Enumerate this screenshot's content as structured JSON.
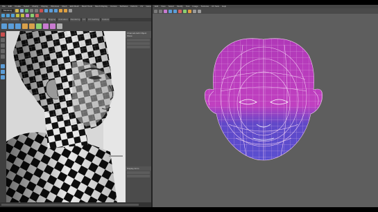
{
  "left_window": {
    "menu": [
      "File",
      "Edit",
      "Create",
      "Select",
      "Modify",
      "Display",
      "Windows",
      "Mesh",
      "Edit Mesh",
      "Mesh Tools",
      "Mesh Display",
      "Curves",
      "Surfaces",
      "Deform",
      "UV",
      "Generate",
      "Cache",
      "Arnold",
      "Help"
    ],
    "mode_selector": "Modeling",
    "shelf_tabs": [
      "Curves / Surfaces",
      "Poly Modeling",
      "Sculpting",
      "Rigging",
      "Animation",
      "Rendering",
      "FX",
      "FX Caching",
      "Custom"
    ],
    "panel_header": "Channels Edit Object Show",
    "layer_header": "Display Anim"
  },
  "right_window": {
    "menu": [
      "Edit",
      "View",
      "Select",
      "Modify",
      "Tool",
      "Image",
      "Textures",
      "UV Sets",
      "Help"
    ]
  },
  "colors": {
    "uv_fill_top": "#c040c0",
    "uv_fill_bottom": "#5a4fd0",
    "uv_line": "#f0c8f0",
    "checker_dark": "#111111",
    "checker_light": "#e8e8e8"
  }
}
